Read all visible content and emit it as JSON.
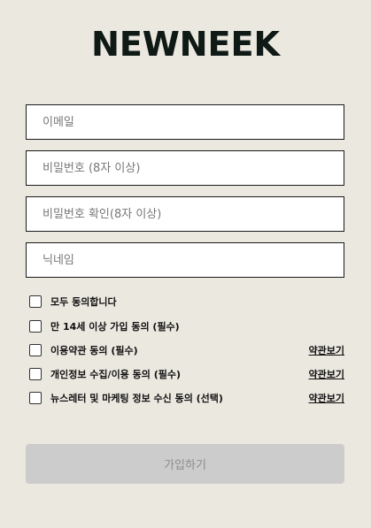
{
  "brand": {
    "logo_text": "NEWNEEK"
  },
  "form": {
    "email_placeholder": "이메일",
    "password_placeholder": "비밀번호 (8자 이상)",
    "password_confirm_placeholder": "비밀번호 확인(8자 이상)",
    "nickname_placeholder": "닉네임"
  },
  "agreements": [
    {
      "label": "모두 동의합니다",
      "checked": false
    },
    {
      "label": "만 14세 이상 가입 동의 (필수)",
      "checked": false
    },
    {
      "label": "이용약관 동의 (필수)",
      "checked": false,
      "link": "약관보기"
    },
    {
      "label": "개인정보 수집/이용 동의 (필수)",
      "checked": false,
      "link": "약관보기"
    },
    {
      "label": "뉴스레터 및 마케팅 정보 수신 동의 (선택)",
      "checked": false,
      "link": "약관보기"
    }
  ],
  "submit": {
    "label": "가입하기",
    "enabled": false
  },
  "colors": {
    "background": "#ebe8e0",
    "logo": "#0f1a17",
    "button_disabled": "#cdcccc",
    "button_text_disabled": "#8c8c8c"
  }
}
